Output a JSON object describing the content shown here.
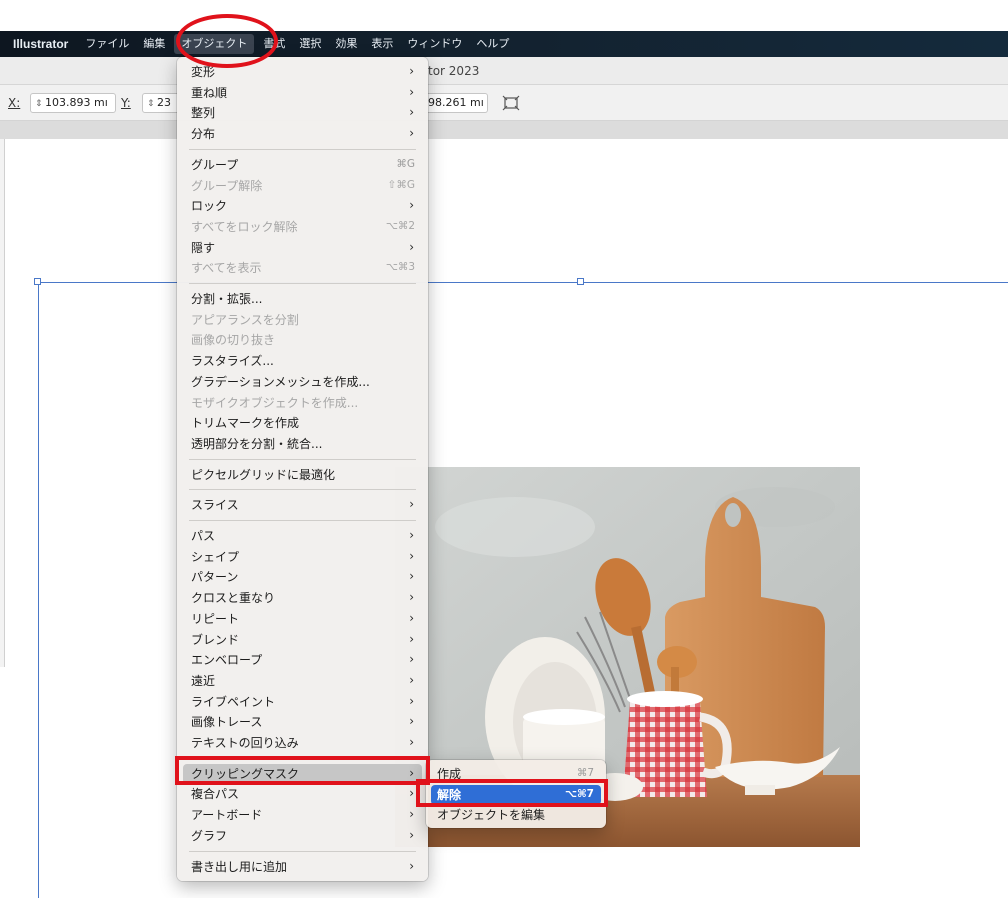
{
  "menubar": {
    "app": "Illustrator",
    "items": [
      "ファイル",
      "編集",
      "オブジェクト",
      "書式",
      "選択",
      "効果",
      "表示",
      "ウィンドウ",
      "ヘルプ"
    ],
    "active_index": 2
  },
  "titlebar": {
    "title": "tor 2023"
  },
  "controlbar": {
    "x_label": "X:",
    "x_value": "103.893 mı",
    "y_label": "Y:",
    "y_value": "23",
    "w_value": "98.261 mı"
  },
  "object_menu": {
    "items": [
      {
        "label": "変形",
        "submenu": true
      },
      {
        "label": "重ね順",
        "submenu": true
      },
      {
        "label": "整列",
        "submenu": true
      },
      {
        "label": "分布",
        "submenu": true
      },
      {
        "separator": true
      },
      {
        "label": "グループ",
        "shortcut": "⌘G"
      },
      {
        "label": "グループ解除",
        "shortcut": "⇧⌘G",
        "disabled": true
      },
      {
        "label": "ロック",
        "submenu": true
      },
      {
        "label": "すべてをロック解除",
        "shortcut": "⌥⌘2",
        "disabled": true
      },
      {
        "label": "隠す",
        "submenu": true
      },
      {
        "label": "すべてを表示",
        "shortcut": "⌥⌘3",
        "disabled": true
      },
      {
        "separator": true
      },
      {
        "label": "分割・拡張..."
      },
      {
        "label": "アピアランスを分割",
        "disabled": true
      },
      {
        "label": "画像の切り抜き",
        "disabled": true
      },
      {
        "label": "ラスタライズ..."
      },
      {
        "label": "グラデーションメッシュを作成..."
      },
      {
        "label": "モザイクオブジェクトを作成...",
        "disabled": true
      },
      {
        "label": "トリムマークを作成"
      },
      {
        "label": "透明部分を分割・統合..."
      },
      {
        "separator": true
      },
      {
        "label": "ピクセルグリッドに最適化"
      },
      {
        "separator": true
      },
      {
        "label": "スライス",
        "submenu": true
      },
      {
        "separator": true
      },
      {
        "label": "パス",
        "submenu": true
      },
      {
        "label": "シェイプ",
        "submenu": true
      },
      {
        "label": "パターン",
        "submenu": true
      },
      {
        "label": "クロスと重なり",
        "submenu": true
      },
      {
        "label": "リピート",
        "submenu": true
      },
      {
        "label": "ブレンド",
        "submenu": true
      },
      {
        "label": "エンベロープ",
        "submenu": true
      },
      {
        "label": "遠近",
        "submenu": true
      },
      {
        "label": "ライブペイント",
        "submenu": true
      },
      {
        "label": "画像トレース",
        "submenu": true
      },
      {
        "label": "テキストの回り込み",
        "submenu": true
      },
      {
        "separator": true
      },
      {
        "label": "クリッピングマスク",
        "submenu": true,
        "hover": true
      },
      {
        "label": "複合パス",
        "submenu": true
      },
      {
        "label": "アートボード",
        "submenu": true
      },
      {
        "label": "グラフ",
        "submenu": true
      },
      {
        "separator": true
      },
      {
        "label": "書き出し用に追加",
        "submenu": true
      }
    ]
  },
  "clipping_submenu": {
    "items": [
      {
        "label": "作成",
        "shortcut": "⌘7"
      },
      {
        "label": "解除",
        "shortcut": "⌥⌘7",
        "selected": true
      },
      {
        "label": "オブジェクトを編集"
      }
    ]
  },
  "colors": {
    "annotation": "#e0121b",
    "selection": "#2f6ed6",
    "guide": "#4a78c8"
  }
}
